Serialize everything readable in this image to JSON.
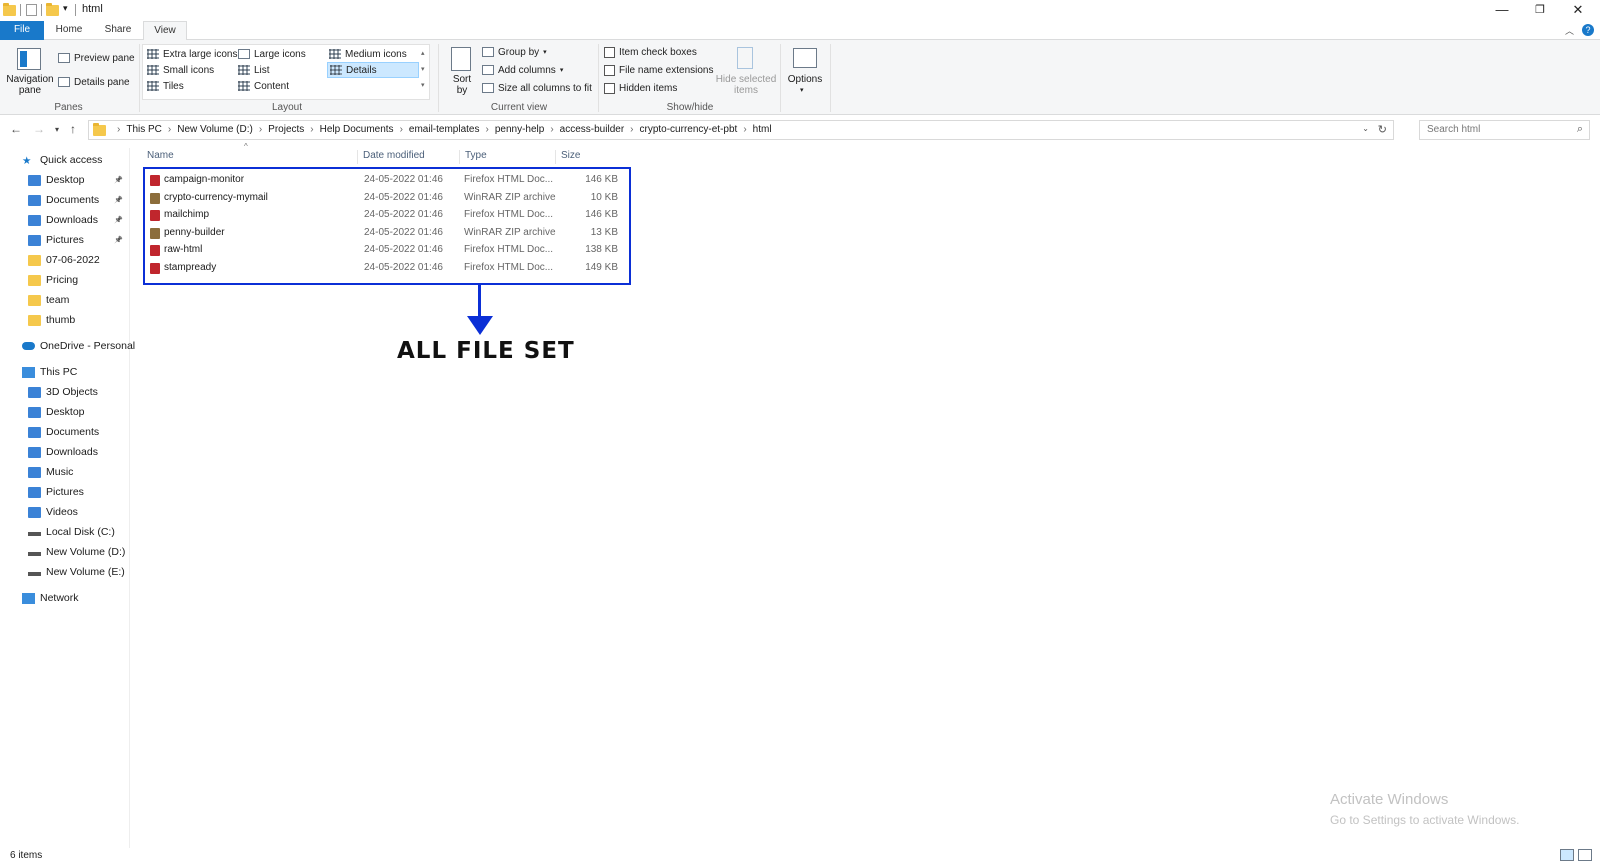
{
  "window": {
    "title": "html",
    "minimize": "—",
    "maximize": "❐",
    "close": "✕"
  },
  "ribbon_tabs": {
    "file": "File",
    "home": "Home",
    "share": "Share",
    "view": "View"
  },
  "ribbon": {
    "panes": {
      "navigation_pane": "Navigation pane",
      "preview_pane": "Preview pane",
      "details_pane": "Details pane",
      "group_label": "Panes"
    },
    "layout": {
      "items": [
        "Extra large icons",
        "Large icons",
        "Medium icons",
        "Small icons",
        "List",
        "Details",
        "Tiles",
        "Content"
      ],
      "selected": "Details",
      "group_label": "Layout"
    },
    "current_view": {
      "sort_by": "Sort by",
      "group_by": "Group by",
      "add_columns": "Add columns",
      "size_columns": "Size all columns to fit",
      "group_label": "Current view"
    },
    "show_hide": {
      "item_check_boxes": "Item check boxes",
      "file_name_extensions": "File name extensions",
      "hidden_items": "Hidden items",
      "hide_selected": "Hide selected items",
      "group_label": "Show/hide"
    },
    "options": "Options"
  },
  "address": {
    "crumbs": [
      "This PC",
      "New Volume (D:)",
      "Projects",
      "Help Documents",
      "email-templates",
      "penny-help",
      "access-builder",
      "crypto-currency-et-pbt",
      "html"
    ],
    "search_placeholder": "Search html"
  },
  "nav": {
    "quick_access": "Quick access",
    "quick_items": [
      "Desktop",
      "Documents",
      "Downloads",
      "Pictures",
      "07-06-2022",
      "Pricing",
      "team",
      "thumb"
    ],
    "onedrive": "OneDrive - Personal",
    "this_pc": "This PC",
    "pc_items": [
      "3D Objects",
      "Desktop",
      "Documents",
      "Downloads",
      "Music",
      "Pictures",
      "Videos",
      "Local Disk (C:)",
      "New Volume (D:)",
      "New Volume (E:)"
    ],
    "selected": "New Volume (D:)",
    "network": "Network"
  },
  "columns": {
    "name": "Name",
    "date": "Date modified",
    "type": "Type",
    "size": "Size"
  },
  "files": [
    {
      "name": "campaign-monitor",
      "date": "24-05-2022 01:46",
      "type": "Firefox HTML Doc...",
      "size": "146 KB",
      "kind": "html"
    },
    {
      "name": "crypto-currency-mymail",
      "date": "24-05-2022 01:46",
      "type": "WinRAR ZIP archive",
      "size": "10 KB",
      "kind": "zip"
    },
    {
      "name": "mailchimp",
      "date": "24-05-2022 01:46",
      "type": "Firefox HTML Doc...",
      "size": "146 KB",
      "kind": "html"
    },
    {
      "name": "penny-builder",
      "date": "24-05-2022 01:46",
      "type": "WinRAR ZIP archive",
      "size": "13 KB",
      "kind": "zip"
    },
    {
      "name": "raw-html",
      "date": "24-05-2022 01:46",
      "type": "Firefox HTML Doc...",
      "size": "138 KB",
      "kind": "html"
    },
    {
      "name": "stampready",
      "date": "24-05-2022 01:46",
      "type": "Firefox HTML Doc...",
      "size": "149 KB",
      "kind": "html"
    }
  ],
  "annotation": {
    "label": "ALL FILE SET",
    "color": "#0b2fd6"
  },
  "watermark": {
    "line1": "Activate Windows",
    "line2": "Go to Settings to activate Windows."
  },
  "status": {
    "items": "6 items"
  },
  "colors": {
    "accent": "#1979ca",
    "selection": "#cde3f7",
    "html_icon": "#c0262d",
    "zip_icon": "#8c6d3b"
  }
}
